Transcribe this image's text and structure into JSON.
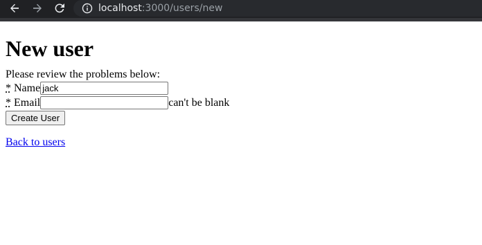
{
  "browser": {
    "url_host": "localhost",
    "url_rest": ":3000/users/new"
  },
  "page": {
    "title": "New user",
    "error_summary": "Please review the problems below:",
    "required_marker": "*",
    "name_label": "Name",
    "name_value": "jack",
    "email_label": "Email",
    "email_value": "",
    "email_error": "can't be blank",
    "submit_label": "Create User",
    "back_link": "Back to users"
  },
  "icons": {
    "back": "arrow-left-icon",
    "forward": "arrow-right-icon",
    "reload": "reload-icon",
    "info": "info-icon"
  },
  "colors": {
    "browser_bg": "#202124",
    "omnibox_bg": "#282a2e",
    "link": "#0000ee"
  }
}
